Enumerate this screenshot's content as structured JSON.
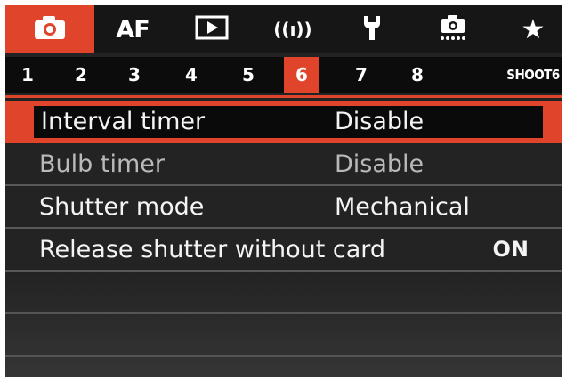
{
  "top_tabs": [
    {
      "id": "shooting",
      "icon": "camera-icon",
      "active": true
    },
    {
      "id": "af",
      "label": "AF",
      "active": false
    },
    {
      "id": "playback",
      "icon": "playback-icon",
      "active": false
    },
    {
      "id": "wireless",
      "label": "((ı))",
      "icon": "wireless-icon",
      "active": false
    },
    {
      "id": "setup",
      "icon": "wrench-icon",
      "active": false
    },
    {
      "id": "custom",
      "icon": "custom-functions-icon",
      "active": false
    },
    {
      "id": "mymenu",
      "label": "★",
      "icon": "star-icon",
      "active": false
    }
  ],
  "number_tabs": {
    "items": [
      "1",
      "2",
      "3",
      "4",
      "5",
      "6",
      "7",
      "8"
    ],
    "active": "6",
    "section_label": "SHOOT6"
  },
  "menu": {
    "items": [
      {
        "label": "Interval timer",
        "value": "Disable",
        "selected": true,
        "enabled": true
      },
      {
        "label": "Bulb timer",
        "value": "Disable",
        "selected": false,
        "enabled": false
      },
      {
        "label": "Shutter mode",
        "value": "Mechanical",
        "selected": false,
        "enabled": true
      },
      {
        "label": "Release shutter without card",
        "value": "ON",
        "selected": false,
        "enabled": true
      }
    ]
  },
  "colors": {
    "accent": "#e0442a",
    "background": "#232323",
    "text": "#f4f4f4",
    "disabled_text": "#b9b9b9"
  }
}
